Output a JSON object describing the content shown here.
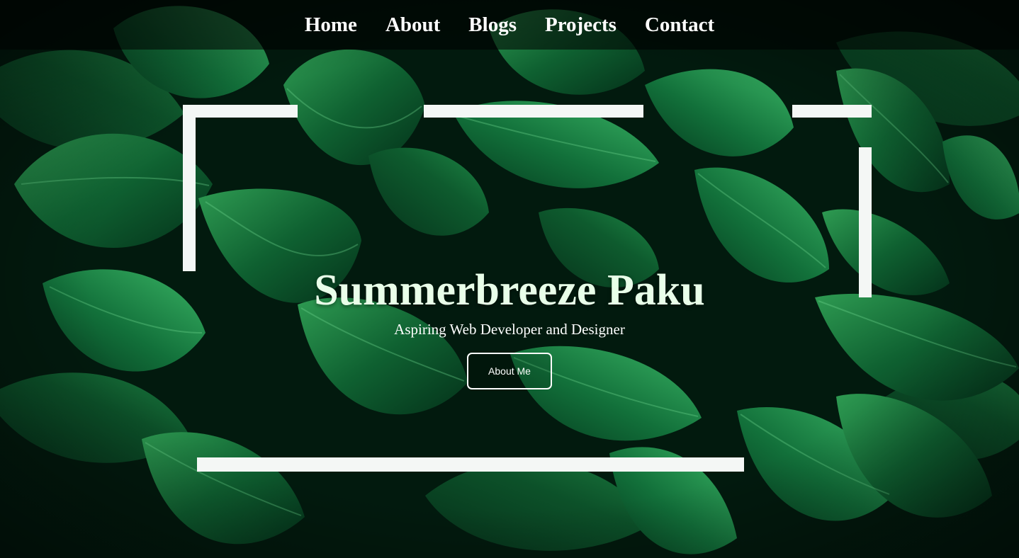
{
  "nav": {
    "items": [
      {
        "label": "Home"
      },
      {
        "label": "About"
      },
      {
        "label": "Blogs"
      },
      {
        "label": "Projects"
      },
      {
        "label": "Contact"
      }
    ]
  },
  "hero": {
    "title": "Summerbreeze Paku",
    "subtitle": "Aspiring Web Developer and Designer",
    "button_label": "About Me"
  },
  "colors": {
    "leaf_dark": "#03210f",
    "leaf_mid": "#0d5a2c",
    "leaf_light": "#2fa85a",
    "frame": "#f4f7f5",
    "title": "#e9ffe9"
  }
}
